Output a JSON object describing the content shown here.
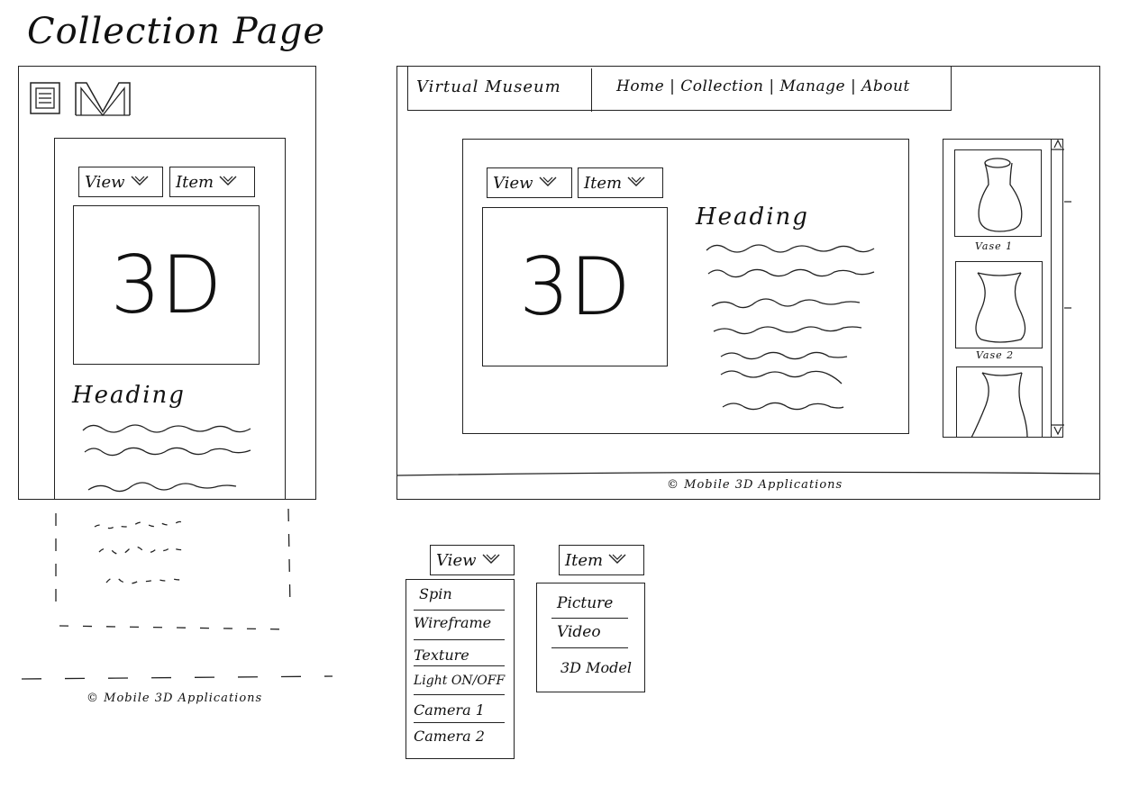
{
  "page_title": "Collection Page",
  "mobile": {
    "logo": "VM",
    "view_dropdown": "View",
    "item_dropdown": "Item",
    "viewer_label": "3D",
    "heading": "Heading",
    "footer": "© Mobile 3D Applications"
  },
  "desktop": {
    "site_name": "Virtual Museum",
    "nav": [
      "Home",
      "Collection",
      "Manage",
      "About"
    ],
    "view_dropdown": "View",
    "item_dropdown": "Item",
    "viewer_label": "3D",
    "heading": "Heading",
    "gallery": [
      {
        "label": "Vase 1"
      },
      {
        "label": "Vase 2"
      },
      {
        "label": ""
      }
    ],
    "footer": "© Mobile 3D Applications"
  },
  "view_menu": {
    "label": "View",
    "items": [
      "Spin",
      "Wireframe",
      "Texture",
      "Light ON/OFF",
      "Camera 1",
      "Camera 2"
    ]
  },
  "item_menu": {
    "label": "Item",
    "items": [
      "Picture",
      "Video",
      "3D Model"
    ]
  }
}
